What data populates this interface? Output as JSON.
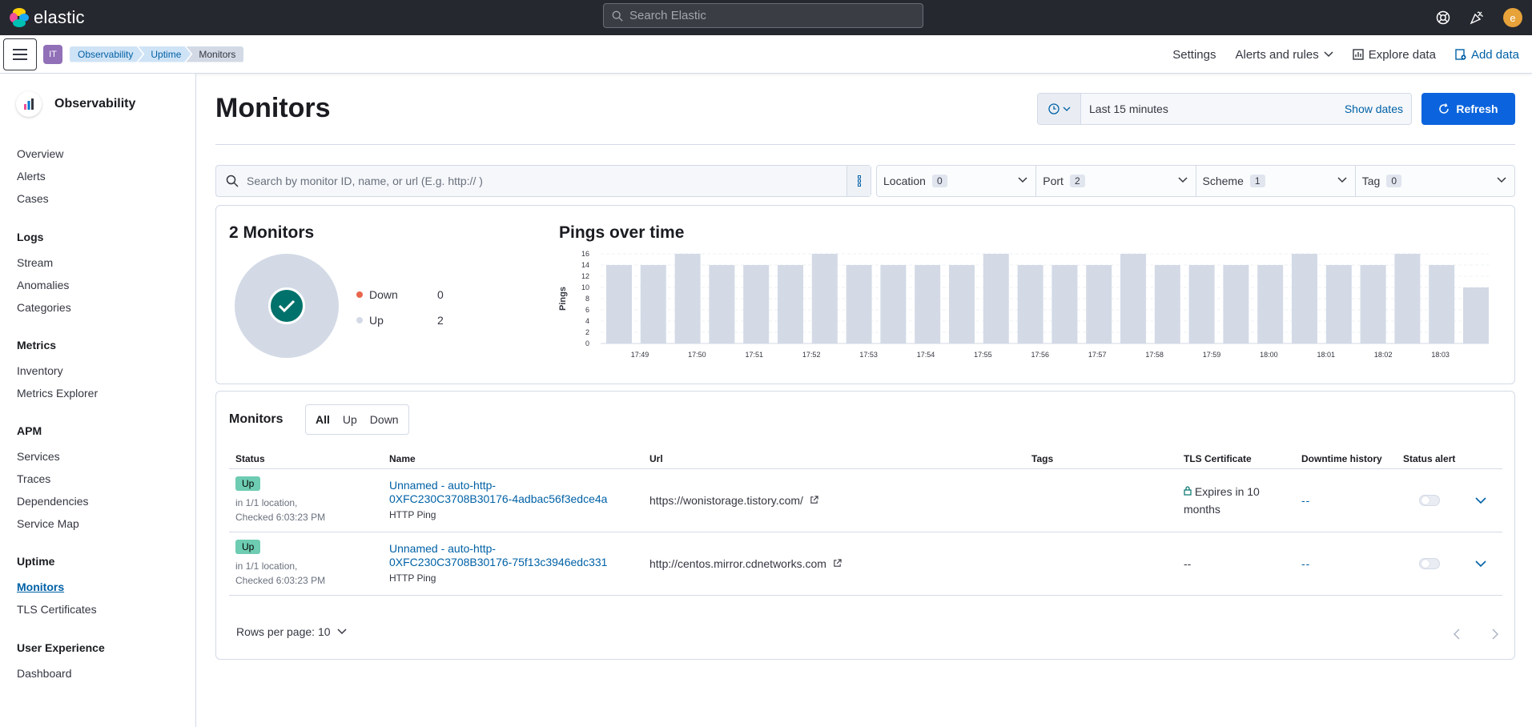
{
  "topbar": {
    "logo_text": "elastic",
    "search_placeholder": "Search Elastic",
    "avatar_letter": "e"
  },
  "subbar": {
    "space_badge": "IT",
    "breadcrumbs": [
      "Observability",
      "Uptime",
      "Monitors"
    ],
    "settings": "Settings",
    "alerts_rules": "Alerts and rules",
    "explore_data": "Explore data",
    "add_data": "Add data"
  },
  "sidebar": {
    "title": "Observability",
    "groups": [
      {
        "title": "",
        "items": [
          "Overview",
          "Alerts",
          "Cases"
        ]
      },
      {
        "title": "Logs",
        "items": [
          "Stream",
          "Anomalies",
          "Categories"
        ]
      },
      {
        "title": "Metrics",
        "items": [
          "Inventory",
          "Metrics Explorer"
        ]
      },
      {
        "title": "APM",
        "items": [
          "Services",
          "Traces",
          "Dependencies",
          "Service Map"
        ]
      },
      {
        "title": "Uptime",
        "items": [
          "Monitors",
          "TLS Certificates"
        ]
      },
      {
        "title": "User Experience",
        "items": [
          "Dashboard"
        ]
      }
    ]
  },
  "main": {
    "title": "Monitors",
    "time_range": "Last 15 minutes",
    "show_dates": "Show dates",
    "refresh": "Refresh",
    "search_placeholder": "Search by monitor ID, name, or url (E.g. http:// )",
    "filters": [
      {
        "label": "Location",
        "count": "0"
      },
      {
        "label": "Port",
        "count": "2"
      },
      {
        "label": "Scheme",
        "count": "1"
      },
      {
        "label": "Tag",
        "count": "0"
      }
    ],
    "summary": {
      "count_title": "2 Monitors",
      "down_label": "Down",
      "down_value": "0",
      "up_label": "Up",
      "up_value": "2",
      "colors": {
        "down": "#e7664c",
        "up": "#d3dae6",
        "ok": "#00726b"
      }
    },
    "pings_title": "Pings over time",
    "monitors_table": {
      "heading": "Monitors",
      "status_filters": [
        "All",
        "Up",
        "Down"
      ],
      "columns": [
        "Status",
        "Name",
        "Url",
        "Tags",
        "TLS Certificate",
        "Downtime history",
        "Status alert"
      ],
      "rows": [
        {
          "status": "Up",
          "location": "in 1/1 location,",
          "checked": "Checked 6:03:23 PM",
          "name_line1": "Unnamed - auto-http-",
          "name_line2": "0XFC230C3708B30176-4adbac56f3edce4a",
          "type": "HTTP Ping",
          "url": "https://wonistorage.tistory.com/",
          "tags": "",
          "tls": "Expires in 10 months",
          "downtime": "--"
        },
        {
          "status": "Up",
          "location": "in 1/1 location,",
          "checked": "Checked 6:03:23 PM",
          "name_line1": "Unnamed - auto-http-",
          "name_line2": "0XFC230C3708B30176-75f13c3946edc331",
          "type": "HTTP Ping",
          "url": "http://centos.mirror.cdnetworks.com",
          "tags": "",
          "tls": "--",
          "downtime": "--"
        }
      ],
      "rows_per_page": "Rows per page: 10"
    }
  },
  "chart_data": {
    "type": "bar",
    "title": "Pings over time",
    "ylabel": "Pings",
    "xlabel": "",
    "ylim": [
      0,
      16
    ],
    "yticks": [
      0,
      2,
      4,
      6,
      8,
      10,
      12,
      14,
      16
    ],
    "xtick_labels": [
      "17:49",
      "17:50",
      "17:51",
      "17:52",
      "17:53",
      "17:54",
      "17:55",
      "17:56",
      "17:57",
      "17:58",
      "17:59",
      "18:00",
      "18:01",
      "18:02",
      "18:03"
    ],
    "values": [
      14,
      14,
      16,
      14,
      14,
      14,
      16,
      14,
      14,
      14,
      14,
      16,
      14,
      14,
      14,
      16,
      14,
      14,
      14,
      14,
      16,
      14,
      14,
      16,
      14,
      10
    ],
    "bar_color": "#d3dae6",
    "grid": true
  }
}
